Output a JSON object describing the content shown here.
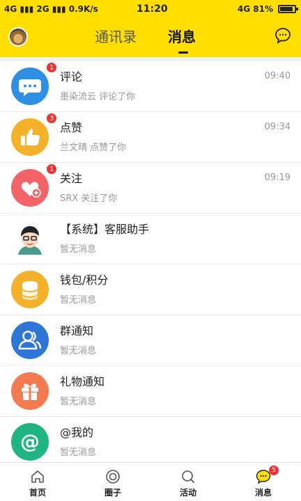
{
  "status_bar": {
    "left": "4G ▮▮▮ 2G ▮▮▮ 0.9K/s",
    "time": "11:20",
    "right": "4G 81%"
  },
  "header": {
    "tabs": [
      {
        "label": "通讯录",
        "active": false
      },
      {
        "label": "消息",
        "active": true
      }
    ],
    "icons": [
      "avatar",
      "chat-bubble-icon"
    ]
  },
  "messages": [
    {
      "title": "评论",
      "subtitle": "墨染流云 评论了你",
      "time": "09:40",
      "badge": "1",
      "icon": "comment-icon",
      "color": "#2e8fe3"
    },
    {
      "title": "点赞",
      "subtitle": "兰文晴 点赞了你",
      "time": "09:34",
      "badge": "3",
      "icon": "thumbs-up-icon",
      "color": "#f6b22a"
    },
    {
      "title": "关注",
      "subtitle": "SRX 关注了你",
      "time": "09:19",
      "badge": "1",
      "icon": "heart-plus-icon",
      "color": "#f46367"
    },
    {
      "title": "【系统】客服助手",
      "subtitle": "暂无消息",
      "time": "",
      "badge": "",
      "icon": "service-avatar",
      "color": "#ffffff"
    },
    {
      "title": "钱包/积分",
      "subtitle": "暂无消息",
      "time": "",
      "badge": "",
      "icon": "coins-icon",
      "color": "#f6b22a"
    },
    {
      "title": "群通知",
      "subtitle": "暂无消息",
      "time": "",
      "badge": "",
      "icon": "group-icon",
      "color": "#2e77d6"
    },
    {
      "title": "礼物通知",
      "subtitle": "暂无消息",
      "time": "",
      "badge": "",
      "icon": "gift-icon",
      "color": "#f47b50"
    },
    {
      "title": "@我的",
      "subtitle": "暂无消息",
      "time": "",
      "badge": "",
      "icon": "at-icon",
      "color": "#1fb583"
    }
  ],
  "bottom_nav": [
    {
      "label": "首页",
      "icon": "home-icon",
      "badge": ""
    },
    {
      "label": "圈子",
      "icon": "circle-icon",
      "badge": ""
    },
    {
      "label": "活动",
      "icon": "search-icon",
      "badge": ""
    },
    {
      "label": "消息",
      "icon": "message-icon",
      "badge": "5"
    }
  ]
}
